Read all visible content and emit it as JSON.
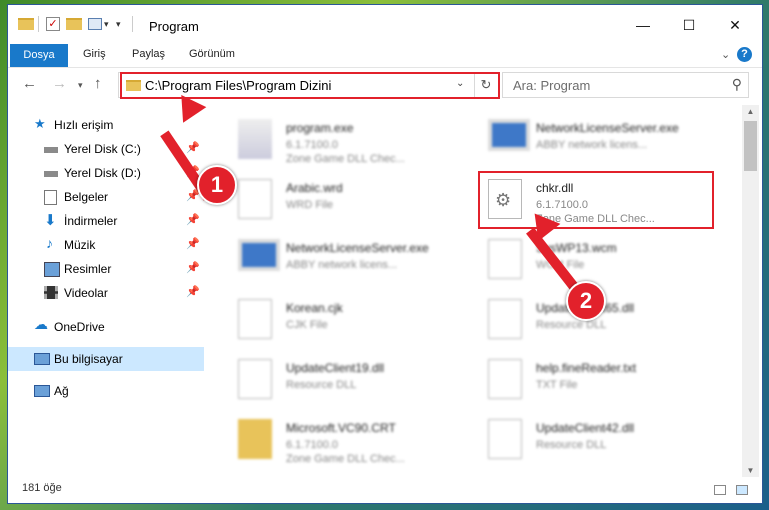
{
  "window": {
    "title": "Program"
  },
  "ribbon": {
    "file_tab": "Dosya",
    "tabs": [
      "Giriş",
      "Paylaş",
      "Görünüm"
    ]
  },
  "address": {
    "path": "C:\\Program Files\\Program Dizini"
  },
  "search": {
    "placeholder": "Ara: Program"
  },
  "sidebar": {
    "items": [
      {
        "label": "Hızlı erişim"
      },
      {
        "label": "Yerel Disk (C:)"
      },
      {
        "label": "Yerel Disk (D:)"
      },
      {
        "label": "Belgeler"
      },
      {
        "label": "İndirmeler"
      },
      {
        "label": "Müzik"
      },
      {
        "label": "Resimler"
      },
      {
        "label": "Videolar"
      },
      {
        "label": "OneDrive"
      },
      {
        "label": "Bu bilgisayar"
      },
      {
        "label": "Ağ"
      }
    ]
  },
  "files": [
    {
      "name": "program.exe",
      "line2": "6.1.7100.0",
      "line3": "Zone Game DLL  Chec..."
    },
    {
      "name": "NetworkLicenseServer.exe",
      "line2": "ABBY network licens...",
      "line3": ""
    },
    {
      "name": "Arabic.wrd",
      "line2": "WRD File",
      "line3": ""
    },
    {
      "name": "chkr.dll",
      "line2": "6.1.7100.0",
      "line3": "Zone Game DLL  Chec..."
    },
    {
      "name": "NetworkLicenseServer.exe",
      "line2": "ABBY network licens...",
      "line3": ""
    },
    {
      "name": "SysWP13.wcm",
      "line2": "WCM File",
      "line3": ""
    },
    {
      "name": "Korean.cjk",
      "line2": "CJK File",
      "line3": ""
    },
    {
      "name": "UpdateClient65.dll",
      "line2": "Resource DLL",
      "line3": ""
    },
    {
      "name": "UpdateClient19.dll",
      "line2": "Resource DLL",
      "line3": ""
    },
    {
      "name": "help.fineReader.txt",
      "line2": "TXT File",
      "line3": ""
    },
    {
      "name": "Microsoft.VC90.CRT",
      "line2": "6.1.7100.0",
      "line3": "Zone Game DLL  Chec..."
    },
    {
      "name": "UpdateClient42.dll",
      "line2": "Resource DLL",
      "line3": ""
    }
  ],
  "status": {
    "count": "181 öğe"
  },
  "annotations": {
    "badge1": "1",
    "badge2": "2"
  },
  "colors": {
    "accent": "#1979ca",
    "highlight": "#e2212b",
    "selected": "#cce8ff"
  }
}
